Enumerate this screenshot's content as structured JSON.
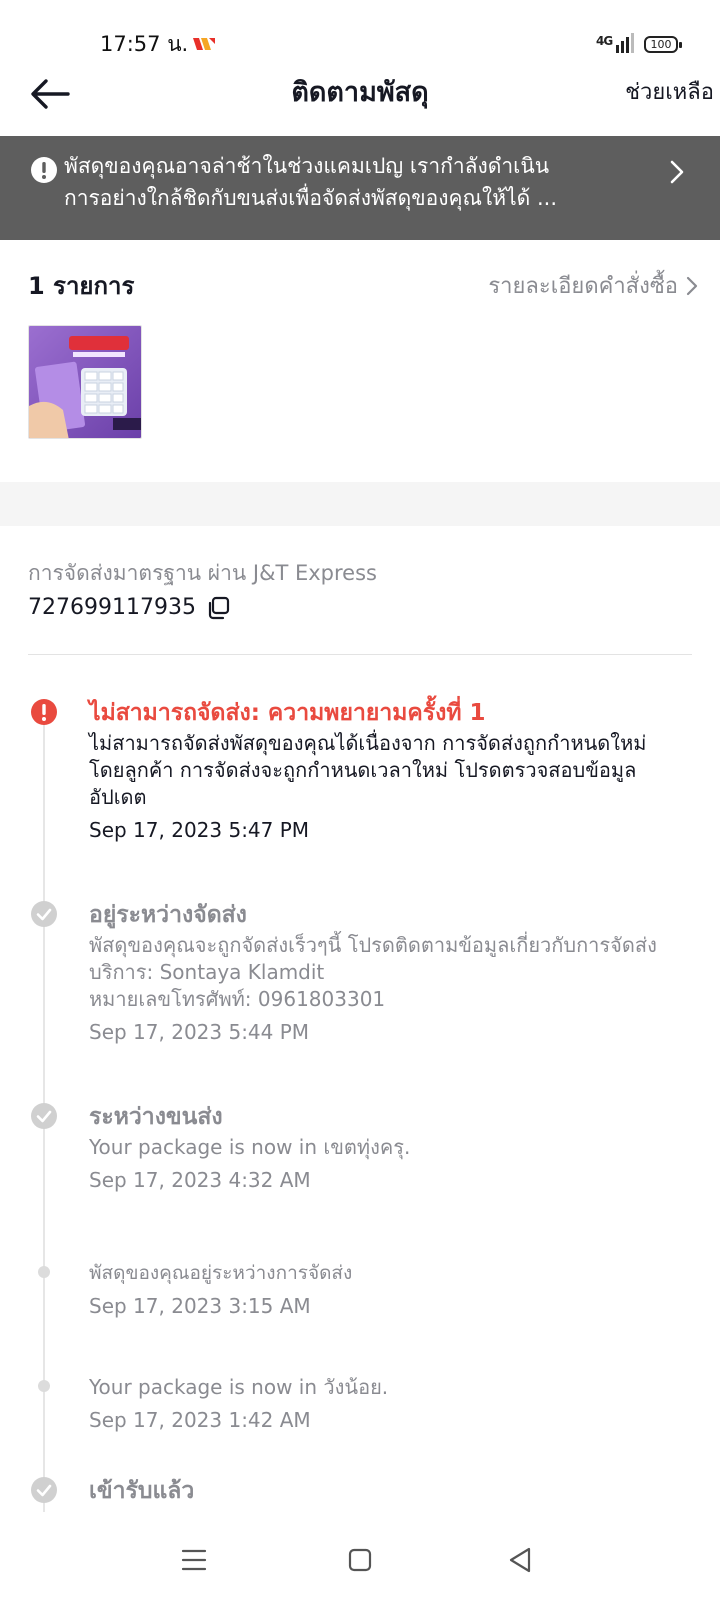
{
  "status_bar": {
    "time": "17:57 น.",
    "network": "4G",
    "battery": "100"
  },
  "header": {
    "title": "ติดตามพัสดุ",
    "help": "ช่วยเหลือ"
  },
  "banner": {
    "line1": "พัสดุของคุณอาจล่าช้าในช่วงแคมเปญ เรากำลังดำเนิน",
    "line2": "การอย่างใกล้ชิดกับขนส่งเพื่อจัดส่งพัสดุของคุณให้ได้ ..."
  },
  "items": {
    "count_label": "1 รายการ",
    "order_details": "รายละเอียดคำสั่งซื้อ"
  },
  "shipping": {
    "method": "การจัดส่งมาตรฐาน ผ่าน J&T Express",
    "tracking_number": "727699117935"
  },
  "timeline": [
    {
      "title": "ไม่สามารถจัดส่ง: ความพยายามครั้งที่ 1",
      "desc_lines": [
        "ไม่สามารถจัดส่งพัสดุของคุณได้เนื่องจาก การจัดส่งถูกกำหนดใหม่",
        "โดยลูกค้า การจัดส่งจะถูกกำหนดเวลาใหม่ โปรดตรวจสอบข้อมูล",
        "อัปเดต"
      ],
      "time": "Sep 17, 2023 5:47 PM"
    },
    {
      "title": "อยู่ระหว่างจัดส่ง",
      "desc_lines": [
        "พัสดุของคุณจะถูกจัดส่งเร็วๆนี้ โปรดติดตามข้อมูลเกี่ยวกับการจัดส่ง",
        "บริการ: Sontaya Klamdit",
        "หมายเลขโทรศัพท์: 0961803301"
      ],
      "time": "Sep 17, 2023 5:44 PM"
    },
    {
      "title": "ระหว่างขนส่ง",
      "desc_lines": [
        "Your package is now in เขตทุ่งครุ."
      ],
      "time": "Sep 17, 2023 4:32 AM"
    },
    {
      "desc_lines": [
        "พัสดุของคุณอยู่ระหว่างการจัดส่ง"
      ],
      "time": "Sep 17, 2023 3:15 AM"
    },
    {
      "desc_lines": [
        "Your package is now in วังน้อย."
      ],
      "time": "Sep 17, 2023 1:42 AM"
    },
    {
      "title": "เข้ารับแล้ว"
    }
  ],
  "colors": {
    "alert": "#e94a3f",
    "banner_bg": "#5e5e5e",
    "muted_text": "#8a8b91"
  },
  "icons": [
    "back-arrow-icon",
    "exclamation-icon",
    "chevron-right-icon",
    "copy-icon",
    "check-icon",
    "menu-icon",
    "home-square-icon",
    "back-triangle-icon"
  ]
}
